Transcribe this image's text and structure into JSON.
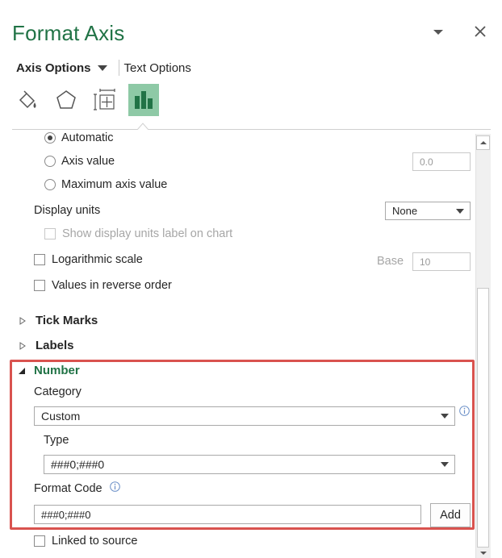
{
  "panel": {
    "title": "Format Axis"
  },
  "tabs": {
    "axis_options": "Axis Options",
    "text_options": "Text Options"
  },
  "icons": [
    "fill-line-icon",
    "effects-icon",
    "size-properties-icon",
    "axis-options-icon"
  ],
  "axis_options": {
    "radio_automatic": "Automatic",
    "radio_axis_value": "Axis value",
    "axis_value": "0.0",
    "radio_maximum": "Maximum axis value",
    "display_units_label": "Display units",
    "display_units_value": "None",
    "show_units_label": "Show display units label on chart",
    "log_scale_label": "Logarithmic scale",
    "base_label": "Base",
    "base_value": "10",
    "reverse_label": "Values in reverse order"
  },
  "sections": {
    "tick_marks": "Tick Marks",
    "labels": "Labels",
    "number": "Number"
  },
  "number": {
    "category_label": "Category",
    "category_value": "Custom",
    "type_label": "Type",
    "type_value": "###0;###0",
    "format_code_label": "Format Code",
    "format_code_value": "###0;###0",
    "add_button": "Add",
    "linked_label": "Linked to source"
  },
  "colors": {
    "accent_green": "#217346",
    "active_icon_bg": "#8ec9a6",
    "highlight_red": "#d9534f"
  }
}
